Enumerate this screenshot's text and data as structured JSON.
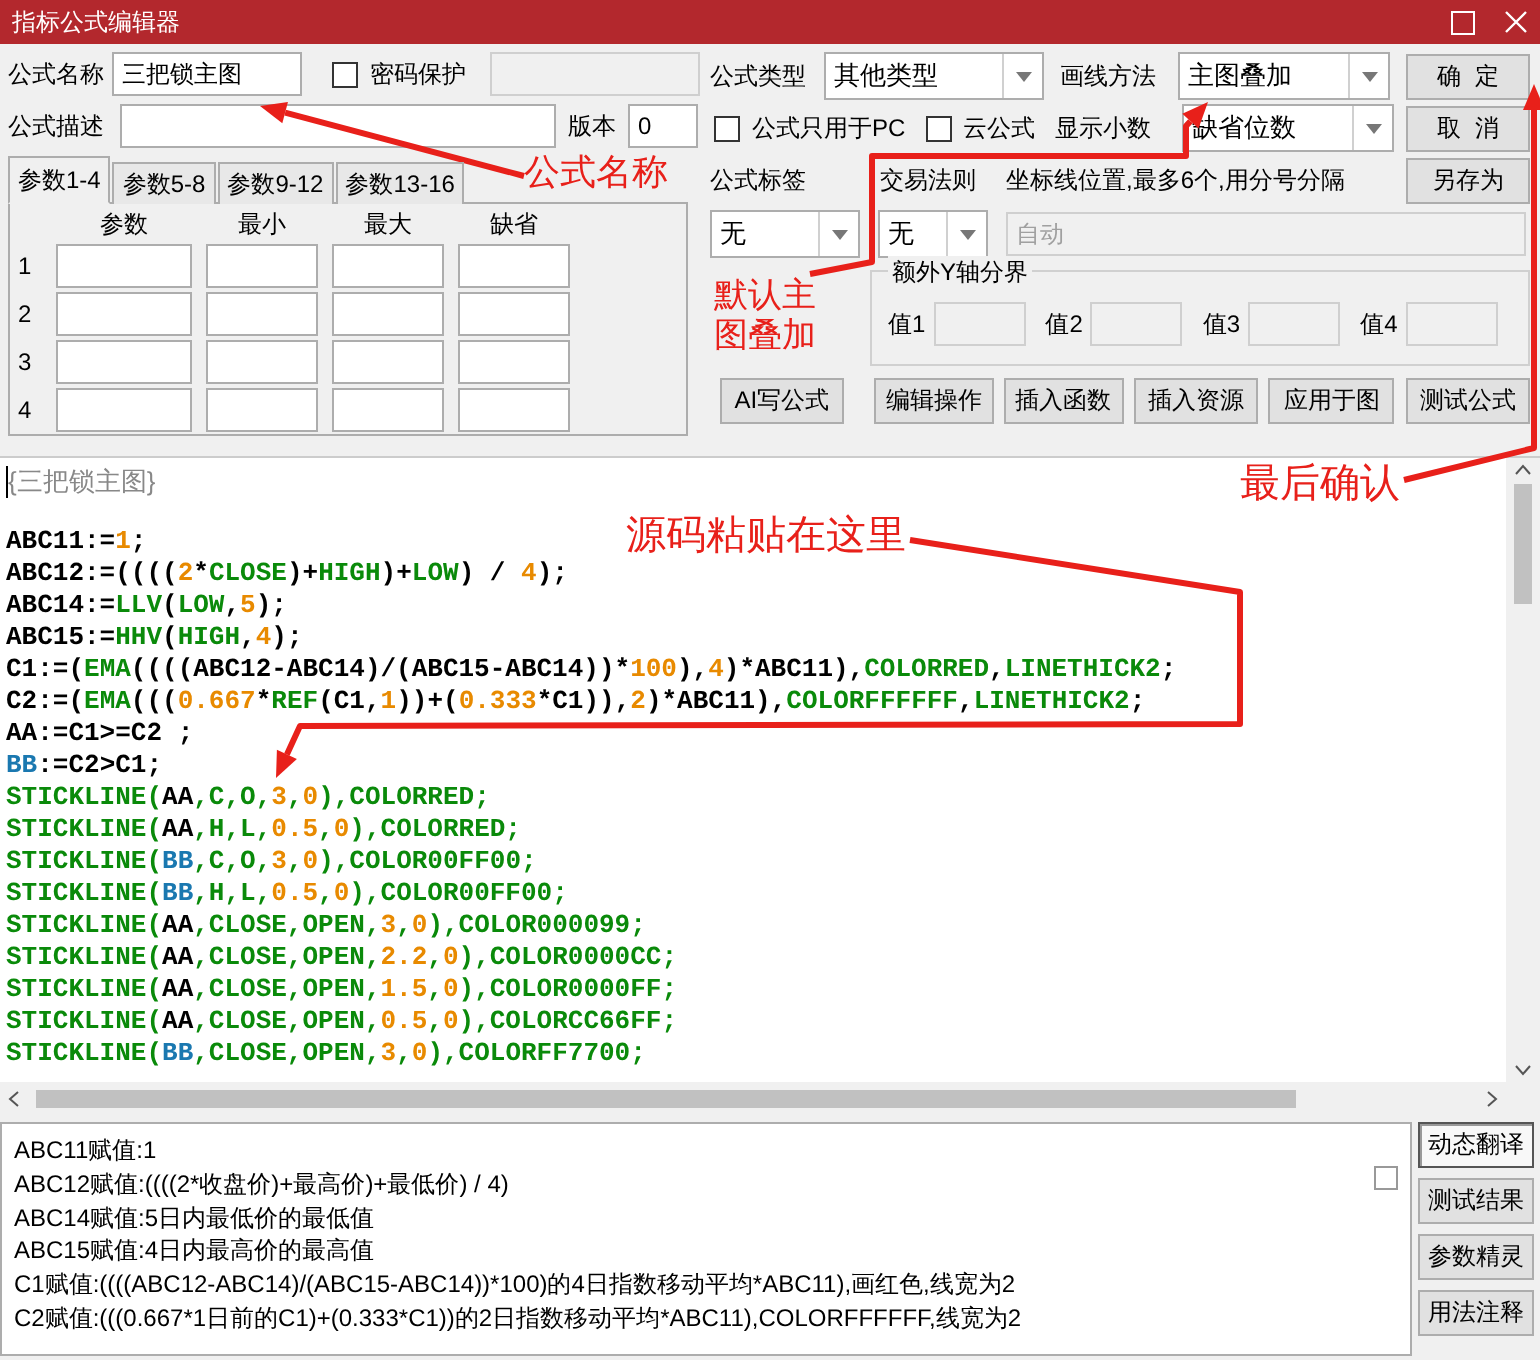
{
  "window": {
    "title": "指标公式编辑器"
  },
  "form": {
    "name": {
      "label": "公式名称",
      "value": "三把锁主图"
    },
    "password": {
      "label": "密码保护",
      "checked": false
    },
    "description": {
      "label": "公式描述"
    },
    "version": {
      "label": "版本",
      "value": "0"
    },
    "formula_type": {
      "label": "公式类型",
      "value": "其他类型"
    },
    "draw_method": {
      "label": "画线方法",
      "value": "主图叠加"
    },
    "pc_only": {
      "label": "公式只用于PC",
      "checked": false
    },
    "cloud": {
      "label": "云公式",
      "checked": false
    },
    "decimals": {
      "label": "显示小数",
      "value": "缺省位数"
    },
    "tag": {
      "label": "公式标签",
      "value": "无"
    },
    "trade_rule": {
      "label": "交易法则",
      "value": "无"
    },
    "axis_lines": {
      "label": "坐标线位置,最多6个,用分号分隔",
      "placeholder": "自动"
    },
    "y_axis": {
      "title": "额外Y轴分界",
      "values": [
        {
          "label": "值1"
        },
        {
          "label": "值2"
        },
        {
          "label": "值3"
        },
        {
          "label": "值4"
        }
      ]
    }
  },
  "param_tabs": [
    {
      "label": "参数1-4",
      "selected": true
    },
    {
      "label": "参数5-8",
      "selected": false
    },
    {
      "label": "参数9-12",
      "selected": false
    },
    {
      "label": "参数13-16",
      "selected": false
    }
  ],
  "param_table": {
    "columns": [
      "参数",
      "最小",
      "最大",
      "缺省"
    ],
    "rows": [
      "1",
      "2",
      "3",
      "4"
    ]
  },
  "side_buttons": [
    "确  定",
    "取  消",
    "另存为"
  ],
  "toolbar_buttons": [
    "AI写公式",
    "编辑操作",
    "插入函数",
    "插入资源",
    "应用于图",
    "测试公式"
  ],
  "code": {
    "comment": "{三把锁主图}",
    "lines": [
      [
        {
          "kind": "plain",
          "text": "ABC11:="
        },
        {
          "kind": "num",
          "text": "1"
        },
        {
          "kind": "plain",
          "text": ";"
        }
      ],
      [
        {
          "kind": "plain",
          "text": "ABC12:=(((("
        },
        {
          "kind": "num",
          "text": "2"
        },
        {
          "kind": "plain",
          "text": "*"
        },
        {
          "kind": "func",
          "text": "CLOSE"
        },
        {
          "kind": "plain",
          "text": ")+"
        },
        {
          "kind": "func",
          "text": "HIGH"
        },
        {
          "kind": "plain",
          "text": ")+"
        },
        {
          "kind": "func",
          "text": "LOW"
        },
        {
          "kind": "plain",
          "text": ") / "
        },
        {
          "kind": "num",
          "text": "4"
        },
        {
          "kind": "plain",
          "text": ");"
        }
      ],
      [
        {
          "kind": "plain",
          "text": "ABC14:="
        },
        {
          "kind": "func",
          "text": "LLV"
        },
        {
          "kind": "plain",
          "text": "("
        },
        {
          "kind": "func",
          "text": "LOW"
        },
        {
          "kind": "plain",
          "text": ","
        },
        {
          "kind": "num",
          "text": "5"
        },
        {
          "kind": "plain",
          "text": ");"
        }
      ],
      [
        {
          "kind": "plain",
          "text": "ABC15:="
        },
        {
          "kind": "func",
          "text": "HHV"
        },
        {
          "kind": "plain",
          "text": "("
        },
        {
          "kind": "func",
          "text": "HIGH"
        },
        {
          "kind": "plain",
          "text": ","
        },
        {
          "kind": "num",
          "text": "4"
        },
        {
          "kind": "plain",
          "text": ");"
        }
      ],
      [
        {
          "kind": "plain",
          "text": "C1:=("
        },
        {
          "kind": "func",
          "text": "EMA"
        },
        {
          "kind": "plain",
          "text": "((((ABC12-ABC14)/(ABC15-ABC14))*"
        },
        {
          "kind": "num",
          "text": "100"
        },
        {
          "kind": "plain",
          "text": "),"
        },
        {
          "kind": "num",
          "text": "4"
        },
        {
          "kind": "plain",
          "text": ")*ABC11),"
        },
        {
          "kind": "func",
          "text": "COLORRED"
        },
        {
          "kind": "plain",
          "text": ","
        },
        {
          "kind": "func",
          "text": "LINETHICK2"
        },
        {
          "kind": "plain",
          "text": ";"
        }
      ],
      [
        {
          "kind": "plain",
          "text": "C2:=("
        },
        {
          "kind": "func",
          "text": "EMA"
        },
        {
          "kind": "plain",
          "text": "((("
        },
        {
          "kind": "num",
          "text": "0.667"
        },
        {
          "kind": "plain",
          "text": "*"
        },
        {
          "kind": "func",
          "text": "REF"
        },
        {
          "kind": "plain",
          "text": "(C1,"
        },
        {
          "kind": "num",
          "text": "1"
        },
        {
          "kind": "plain",
          "text": "))+("
        },
        {
          "kind": "num",
          "text": "0.333"
        },
        {
          "kind": "plain",
          "text": "*C1)),"
        },
        {
          "kind": "num",
          "text": "2"
        },
        {
          "kind": "plain",
          "text": ")*ABC11),"
        },
        {
          "kind": "func",
          "text": "COLORFFFFFF"
        },
        {
          "kind": "plain",
          "text": ","
        },
        {
          "kind": "func",
          "text": "LINETHICK2"
        },
        {
          "kind": "plain",
          "text": ";"
        }
      ],
      [
        {
          "kind": "plain",
          "text": "AA:=C1>=C2 ;"
        }
      ],
      [
        {
          "kind": "var",
          "text": "BB"
        },
        {
          "kind": "plain",
          "text": ":=C2>C1;"
        }
      ],
      [
        {
          "kind": "func",
          "text": "STICKLINE("
        },
        {
          "kind": "plain",
          "text": "AA"
        },
        {
          "kind": "func",
          "text": ",C,O,"
        },
        {
          "kind": "num",
          "text": "3"
        },
        {
          "kind": "func",
          "text": ","
        },
        {
          "kind": "num",
          "text": "0"
        },
        {
          "kind": "func",
          "text": "),COLORRED;"
        }
      ],
      [
        {
          "kind": "func",
          "text": "STICKLINE("
        },
        {
          "kind": "plain",
          "text": "AA"
        },
        {
          "kind": "func",
          "text": ",H,L,"
        },
        {
          "kind": "num",
          "text": "0.5"
        },
        {
          "kind": "func",
          "text": ","
        },
        {
          "kind": "num",
          "text": "0"
        },
        {
          "kind": "func",
          "text": "),COLORRED;"
        }
      ],
      [
        {
          "kind": "func",
          "text": "STICKLINE("
        },
        {
          "kind": "var",
          "text": "BB"
        },
        {
          "kind": "func",
          "text": ",C,O,"
        },
        {
          "kind": "num",
          "text": "3"
        },
        {
          "kind": "func",
          "text": ","
        },
        {
          "kind": "num",
          "text": "0"
        },
        {
          "kind": "func",
          "text": "),COLOR00FF00;"
        }
      ],
      [
        {
          "kind": "func",
          "text": "STICKLINE("
        },
        {
          "kind": "var",
          "text": "BB"
        },
        {
          "kind": "func",
          "text": ",H,L,"
        },
        {
          "kind": "num",
          "text": "0.5"
        },
        {
          "kind": "func",
          "text": ","
        },
        {
          "kind": "num",
          "text": "0"
        },
        {
          "kind": "func",
          "text": "),COLOR00FF00;"
        }
      ],
      [
        {
          "kind": "func",
          "text": "STICKLINE("
        },
        {
          "kind": "plain",
          "text": "AA"
        },
        {
          "kind": "func",
          "text": ",CLOSE,OPEN,"
        },
        {
          "kind": "num",
          "text": "3"
        },
        {
          "kind": "func",
          "text": ","
        },
        {
          "kind": "num",
          "text": "0"
        },
        {
          "kind": "func",
          "text": "),COLOR000099;"
        }
      ],
      [
        {
          "kind": "func",
          "text": "STICKLINE("
        },
        {
          "kind": "plain",
          "text": "AA"
        },
        {
          "kind": "func",
          "text": ",CLOSE,OPEN,"
        },
        {
          "kind": "num",
          "text": "2.2"
        },
        {
          "kind": "func",
          "text": ","
        },
        {
          "kind": "num",
          "text": "0"
        },
        {
          "kind": "func",
          "text": "),COLOR0000CC;"
        }
      ],
      [
        {
          "kind": "func",
          "text": "STICKLINE("
        },
        {
          "kind": "plain",
          "text": "AA"
        },
        {
          "kind": "func",
          "text": ",CLOSE,OPEN,"
        },
        {
          "kind": "num",
          "text": "1.5"
        },
        {
          "kind": "func",
          "text": ","
        },
        {
          "kind": "num",
          "text": "0"
        },
        {
          "kind": "func",
          "text": "),COLOR0000FF;"
        }
      ],
      [
        {
          "kind": "func",
          "text": "STICKLINE("
        },
        {
          "kind": "plain",
          "text": "AA"
        },
        {
          "kind": "func",
          "text": ",CLOSE,OPEN,"
        },
        {
          "kind": "num",
          "text": "0.5"
        },
        {
          "kind": "func",
          "text": ","
        },
        {
          "kind": "num",
          "text": "0"
        },
        {
          "kind": "func",
          "text": "),COLORCC66FF;"
        }
      ],
      [
        {
          "kind": "func",
          "text": "STICKLINE("
        },
        {
          "kind": "var",
          "text": "BB"
        },
        {
          "kind": "func",
          "text": ",CLOSE,OPEN,"
        },
        {
          "kind": "num",
          "text": "3"
        },
        {
          "kind": "func",
          "text": ","
        },
        {
          "kind": "num",
          "text": "0"
        },
        {
          "kind": "func",
          "text": "),COLORFF7700;"
        }
      ]
    ]
  },
  "translation": {
    "checked": false,
    "lines": [
      "ABC11赋值:1",
      "ABC12赋值:((((2*收盘价)+最高价)+最低价) / 4)",
      "ABC14赋值:5日内最低价的最低值",
      "ABC15赋值:4日内最高价的最高值",
      "C1赋值:((((ABC12-ABC14)/(ABC15-ABC14))*100)的4日指数移动平均*ABC11),画红色,线宽为2",
      "C2赋值:(((0.667*1日前的C1)+(0.333*C1))的2日指数移动平均*ABC11),COLORFFFFFF,线宽为2"
    ]
  },
  "translation_buttons": [
    {
      "label": "动态翻译",
      "selected": true
    },
    {
      "label": "测试结果",
      "selected": false
    },
    {
      "label": "参数精灵",
      "selected": false
    },
    {
      "label": "用法注释",
      "selected": false
    }
  ],
  "annotations": [
    {
      "text": "公式名称"
    },
    {
      "text": "默认主图叠加"
    },
    {
      "text": "最后确认"
    },
    {
      "text": "源码粘贴在这里"
    }
  ]
}
